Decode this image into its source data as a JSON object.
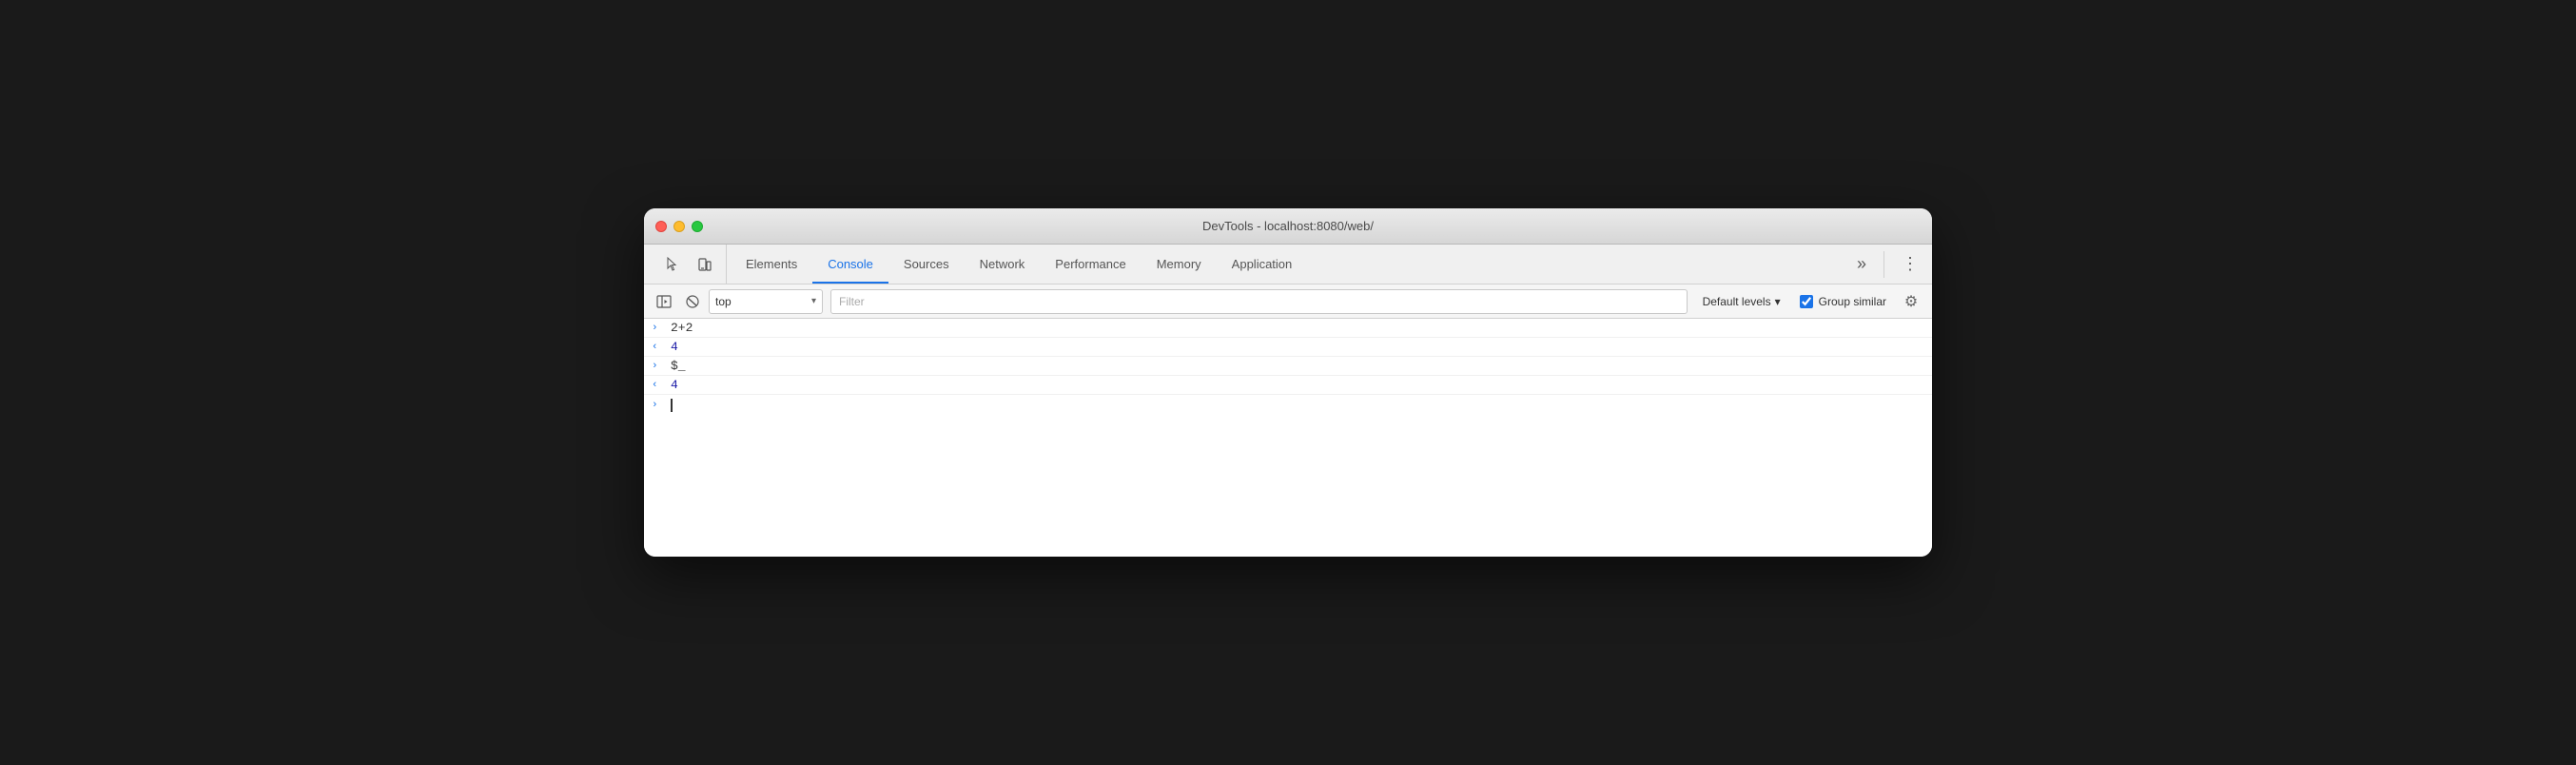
{
  "window": {
    "title": "DevTools - localhost:8080/web/"
  },
  "trafficLights": {
    "close": "close",
    "minimize": "minimize",
    "maximize": "maximize"
  },
  "tabs": [
    {
      "id": "elements",
      "label": "Elements",
      "active": false
    },
    {
      "id": "console",
      "label": "Console",
      "active": true
    },
    {
      "id": "sources",
      "label": "Sources",
      "active": false
    },
    {
      "id": "network",
      "label": "Network",
      "active": false
    },
    {
      "id": "performance",
      "label": "Performance",
      "active": false
    },
    {
      "id": "memory",
      "label": "Memory",
      "active": false
    },
    {
      "id": "application",
      "label": "Application",
      "active": false
    }
  ],
  "moreTabsLabel": "»",
  "toolbar": {
    "contextLabel": "top",
    "filterPlaceholder": "Filter",
    "defaultLevels": "Default levels",
    "groupSimilar": "Group similar"
  },
  "consoleEntries": [
    {
      "id": 1,
      "arrow": ">",
      "arrowClass": "arrow-right",
      "value": "2+2",
      "valueClass": "console-value-input"
    },
    {
      "id": 2,
      "arrow": "<",
      "arrowClass": "arrow-left",
      "value": "4",
      "valueClass": "console-value-blue"
    },
    {
      "id": 3,
      "arrow": ">",
      "arrowClass": "arrow-right",
      "value": "$_",
      "valueClass": "console-value-input"
    },
    {
      "id": 4,
      "arrow": "<",
      "arrowClass": "arrow-left",
      "value": "4",
      "valueClass": "console-value-blue"
    }
  ],
  "promptArrow": ">",
  "icons": {
    "cursor": "cursor-icon",
    "layers": "layers-icon",
    "clear": "clear-icon",
    "sidebar": "sidebar-icon",
    "chevronDown": "▾",
    "settings": "⚙",
    "more": "»",
    "kebab": "⋮"
  }
}
